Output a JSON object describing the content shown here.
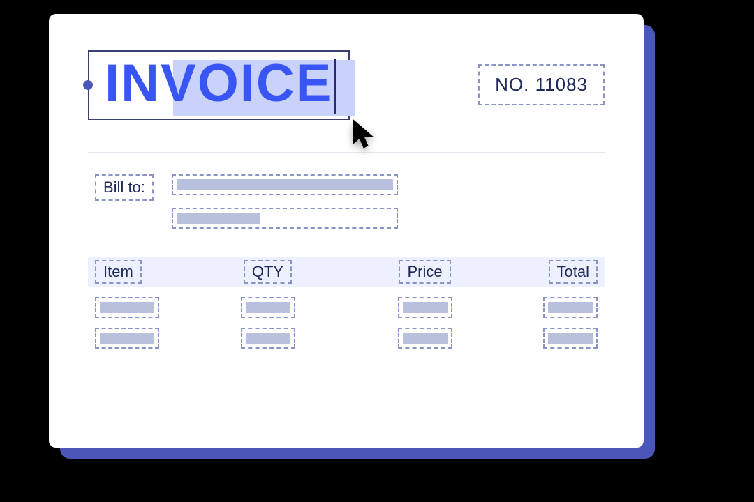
{
  "title": "INVOICE",
  "invoice_number": "NO. 11083",
  "bill_to_label": "Bill to:",
  "columns": {
    "item": "Item",
    "qty": "QTY",
    "price": "Price",
    "total": "Total"
  }
}
